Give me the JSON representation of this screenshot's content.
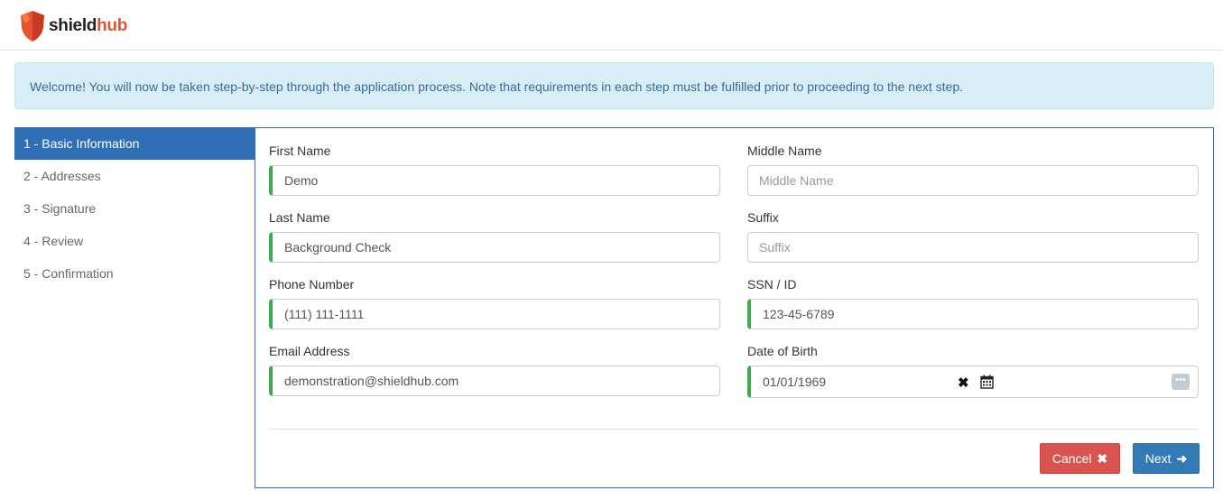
{
  "brand": {
    "name_part1": "shield",
    "name_part2": "hub",
    "accent": "#e05532",
    "logo_icon": "shield-logo-icon"
  },
  "alert": {
    "text": "Welcome! You will now be taken step-by-step through the application process. Note that requirements in each step must be fulfilled prior to proceeding to the next step."
  },
  "steps": [
    {
      "label": "1 - Basic Information",
      "active": true
    },
    {
      "label": "2 - Addresses"
    },
    {
      "label": "3 - Signature"
    },
    {
      "label": "4 - Review"
    },
    {
      "label": "5 - Confirmation"
    }
  ],
  "form": {
    "first_name": {
      "label": "First Name",
      "value": "Demo"
    },
    "middle_name": {
      "label": "Middle Name",
      "value": "",
      "placeholder": "Middle Name"
    },
    "last_name": {
      "label": "Last Name",
      "value": "Background Check"
    },
    "suffix": {
      "label": "Suffix",
      "value": "",
      "placeholder": "Suffix"
    },
    "phone": {
      "label": "Phone Number",
      "value": "(111) 111-1111"
    },
    "ssn": {
      "label": "SSN / ID",
      "value": "123-45-6789"
    },
    "email": {
      "label": "Email Address",
      "value": "demonstration@shieldhub.com"
    },
    "dob": {
      "label": "Date of Birth",
      "value": "01/01/1969",
      "clear_icon": "✖",
      "more_icon": "•••"
    }
  },
  "actions": {
    "cancel_label": "Cancel",
    "cancel_icon": "✖",
    "next_label": "Next",
    "next_icon": "➜"
  },
  "colors": {
    "primary": "#2f6fb6",
    "required": "#3cad4a",
    "danger": "#d9534f",
    "info_bg": "#d9edf7"
  }
}
